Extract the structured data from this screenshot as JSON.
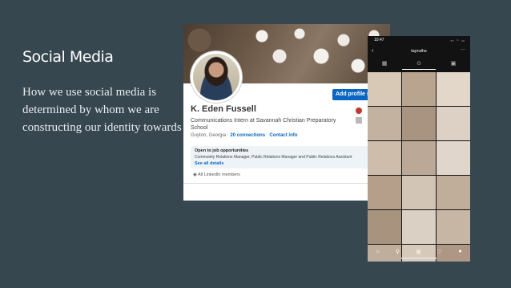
{
  "slide": {
    "title": "Social Media",
    "body": "How we use social media is determined by whom we are constructing our identity towards"
  },
  "linkedin": {
    "action_button": "Add profile se",
    "name": "K. Eden Fussell",
    "headline": "Communications Intern at Savannah Christian Preparatory School",
    "location": "Guyton, Georgia",
    "separator": "·",
    "connections": "20 connections",
    "contact": "Contact info",
    "open_to_title": "Open to job opportunities",
    "open_to_roles": "Community Relations Manager, Public Relations Manager and Public Relations Assistant",
    "see_all": "See all details",
    "visibility": "All LinkedIn members"
  },
  "instagram": {
    "time": "10:47",
    "username": "tayruths",
    "back_icon": "chevron-left-icon",
    "more_icon": "ellipsis-icon",
    "tabs": [
      "grid-icon",
      "reels-icon",
      "tagged-icon"
    ],
    "grid_colors": [
      "#d8c8b6",
      "#b9a48f",
      "#e3d7ca",
      "#c4b2a0",
      "#a99381",
      "#dcd1c4",
      "#cdbdaa",
      "#bba896",
      "#e0d6cb",
      "#b59f8a",
      "#d3c5b5",
      "#c0ad9a",
      "#a8937f",
      "#dad0c4",
      "#c7b6a4",
      "#bfae9b",
      "#d6c9ba",
      "#ae9885"
    ],
    "nav_icons": [
      "home-icon",
      "search-icon",
      "add-post-icon",
      "heart-icon",
      "profile-icon"
    ]
  }
}
